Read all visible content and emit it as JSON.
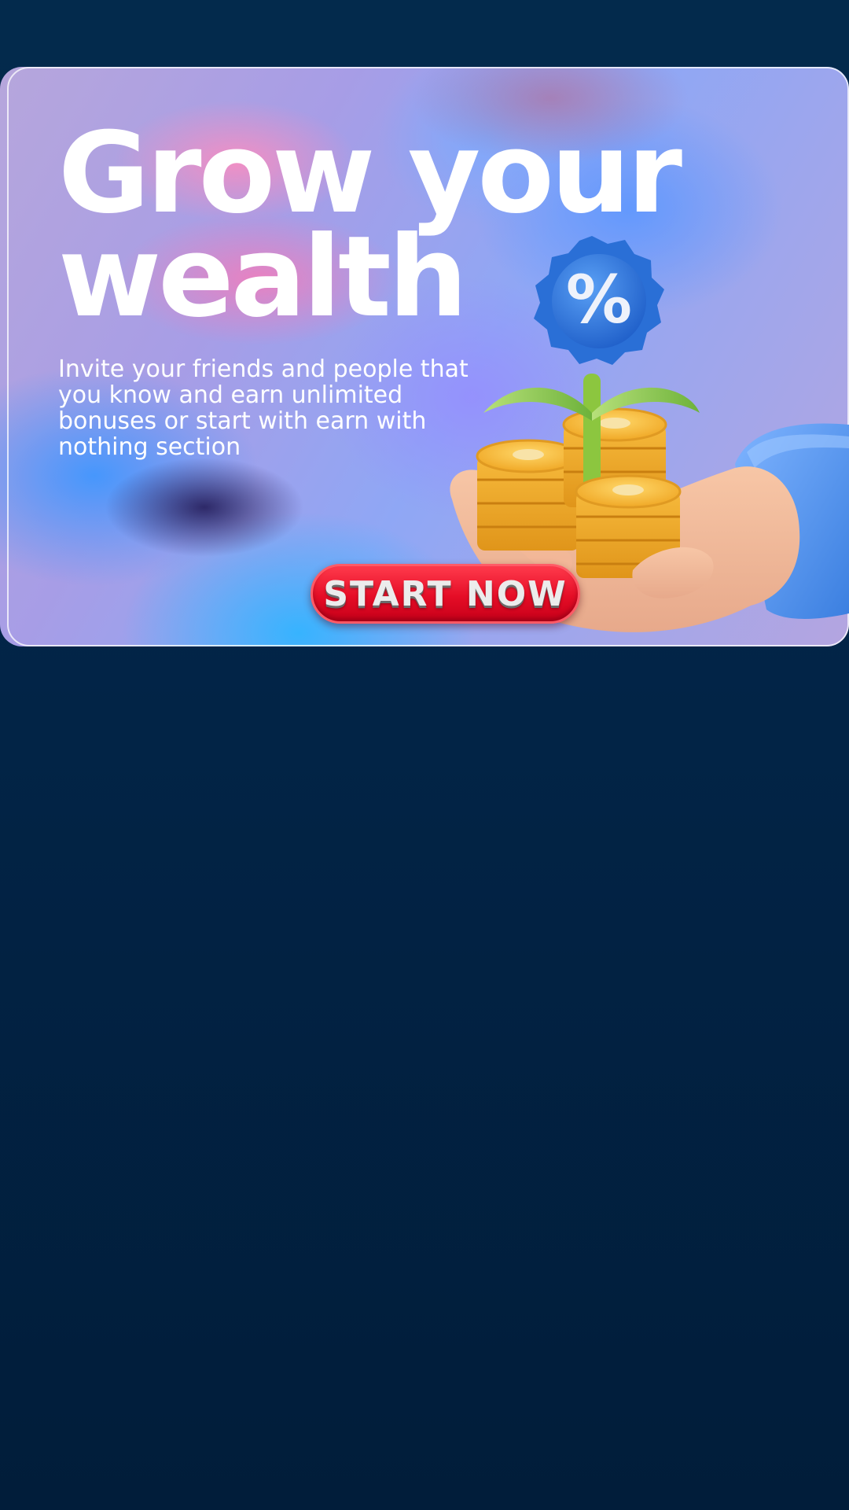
{
  "banner": {
    "headline_line1": "Grow your",
    "headline_line2": "wealth",
    "subtitle": "Invite your friends and people that you know and earn unlimited bonuses  or start with earn with nothing section",
    "cta_label": "START NOW",
    "badge_symbol": "%",
    "illustration_icon": "hand-holding-coins-plant-icon"
  },
  "colors": {
    "page_background": "#022548",
    "cta": "#e50d26",
    "headline": "#ffffff"
  }
}
